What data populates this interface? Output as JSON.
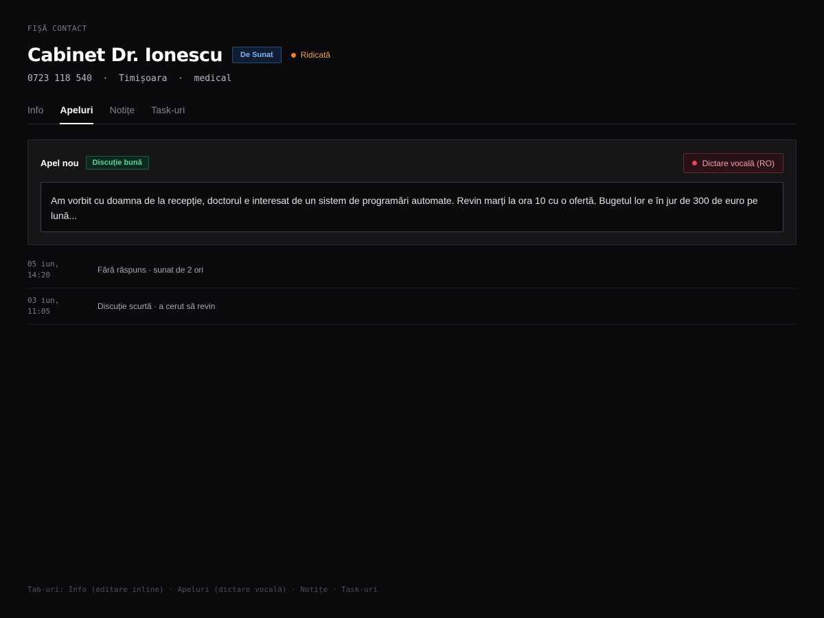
{
  "header": {
    "eyebrow": "FIȘĂ CONTACT",
    "title": "Cabinet Dr. Ionescu",
    "status": "De Sunat",
    "priority": "Ridicată",
    "meta": "0723 118 540  ·  Timișoara  ·  medical"
  },
  "tabs": [
    {
      "label": "Info"
    },
    {
      "label": "Apeluri"
    },
    {
      "label": "Notițe"
    },
    {
      "label": "Task-uri"
    }
  ],
  "active_tab": "Apeluri",
  "new_call": {
    "title": "Apel nou",
    "outcome": "Discuție bună",
    "dictate_label": "Dictare vocală (RO)",
    "note": "Am vorbit cu doamna de la recepție, doctorul e interesat de un sistem de programări automate. Revin marți la ora 10 cu o ofertă. Bugetul lor e în jur de 300 de euro pe lună..."
  },
  "calls": [
    {
      "date": "05 iun,\n14:20",
      "summary": "Fără răspuns · sunat de 2 ori"
    },
    {
      "date": "03 iun,\n11:05",
      "summary": "Discuție scurtă · a cerut să revin"
    }
  ],
  "footer": "Tab-uri: Info (editare inline) · Apeluri (dictare vocală) · Notițe · Task-uri",
  "colors": {
    "background": "#0a0a0c",
    "status_blue": "#7fb2f0",
    "priority_orange": "#f07f2a",
    "outcome_green": "#5ed09a",
    "record_red": "#e8465f"
  },
  "icons": {
    "priority": "dot-icon",
    "dictate": "record-icon"
  }
}
